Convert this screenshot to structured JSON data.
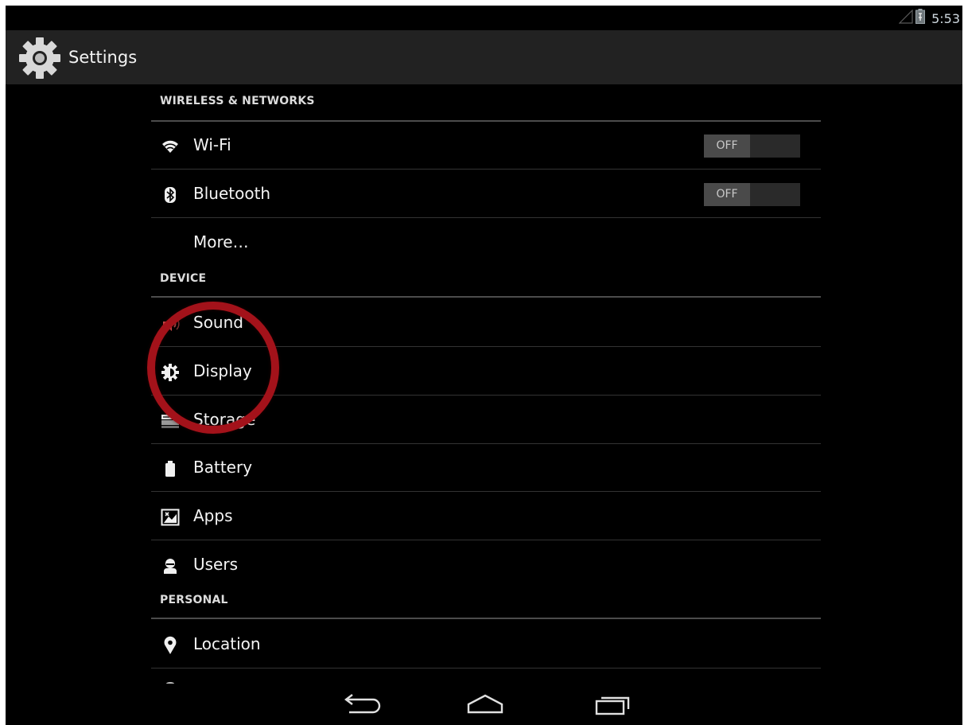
{
  "status_bar": {
    "time": "5:53",
    "signal_icon": "signal-icon",
    "battery_icon": "battery-icon"
  },
  "action_bar": {
    "title": "Settings",
    "icon": "settings-gear-icon"
  },
  "sections": [
    {
      "header": "WIRELESS & NETWORKS"
    },
    {
      "header": "DEVICE"
    },
    {
      "header": "PERSONAL"
    }
  ],
  "items": {
    "wifi": {
      "label": "Wi-Fi",
      "icon": "wifi-icon",
      "toggle": "OFF"
    },
    "bluetooth": {
      "label": "Bluetooth",
      "icon": "bluetooth-icon",
      "toggle": "OFF"
    },
    "more": {
      "label": "More…"
    },
    "sound": {
      "label": "Sound",
      "icon": "speaker-icon"
    },
    "display": {
      "label": "Display",
      "icon": "brightness-icon"
    },
    "storage": {
      "label": "Storage",
      "icon": "storage-icon"
    },
    "battery": {
      "label": "Battery",
      "icon": "battery-icon"
    },
    "apps": {
      "label": "Apps",
      "icon": "apps-icon"
    },
    "users": {
      "label": "Users",
      "icon": "user-icon"
    },
    "location": {
      "label": "Location",
      "icon": "location-pin-icon"
    }
  },
  "nav_bar": {
    "back": "back-icon",
    "home": "home-icon",
    "recents": "recent-apps-icon"
  },
  "colors": {
    "background": "#000000",
    "action_bar": "#222222",
    "annotation": "#a3121a",
    "toggle_off": "#4a4a4a"
  }
}
